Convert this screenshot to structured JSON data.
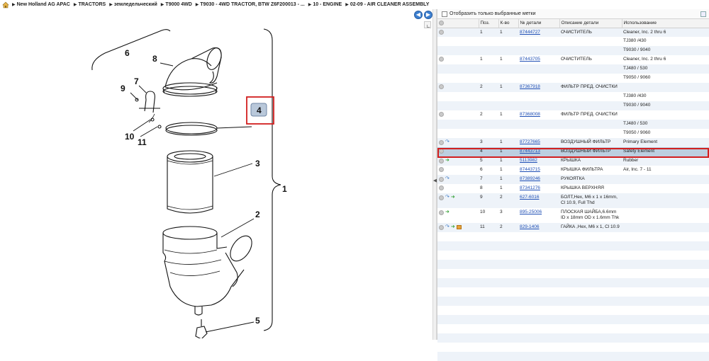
{
  "breadcrumb": {
    "items": [
      "New Holland AG APAC",
      "TRACTORS",
      "земледельческий",
      "T9000 4WD",
      "T9030 - 4WD TRACTOR, BTW Z6F200013 - ...",
      "10 - ENGINE",
      "02-09 - AIR CLEANER ASSEMBLY"
    ]
  },
  "nav": {
    "back_glyph": "◀",
    "forward_glyph": "▶"
  },
  "diagram": {
    "callouts": [
      "1",
      "2",
      "3",
      "4",
      "5",
      "6",
      "7",
      "8",
      "9",
      "10",
      "11"
    ],
    "highlight_color": "#d21f1f"
  },
  "filter": {
    "label": "Отобразить только выбранные метки"
  },
  "table": {
    "headers": [
      "",
      "Поз.",
      "К-во",
      "№ детали",
      "Описание детали",
      "Использование"
    ],
    "rows": [
      {
        "pos": "1",
        "qty": "1",
        "part": "87444727",
        "desc": "ОЧИСТИТЕЛЬ",
        "usage": "Cleaner, Inc. 2 thru 6",
        "icons": [
          "gray"
        ]
      },
      {
        "pos": "",
        "qty": "",
        "part": "",
        "desc": "",
        "usage": "TJ380 /430",
        "icons": []
      },
      {
        "pos": "",
        "qty": "",
        "part": "",
        "desc": "",
        "usage": "T9030 / 9040",
        "icons": []
      },
      {
        "pos": "1",
        "qty": "1",
        "part": "87443705",
        "desc": "ОЧИСТИТЕЛЬ",
        "usage": "Cleaner, Inc. 2 thru 6",
        "icons": [
          "gray"
        ]
      },
      {
        "pos": "",
        "qty": "",
        "part": "",
        "desc": "",
        "usage": "TJ480 / 530",
        "icons": []
      },
      {
        "pos": "",
        "qty": "",
        "part": "",
        "desc": "",
        "usage": "T9050 / 9060",
        "icons": []
      },
      {
        "pos": "2",
        "qty": "1",
        "part": "87367918",
        "desc": "ФИЛЬТР ПРЕД. ОЧИСТКИ",
        "usage": "",
        "icons": [
          "gray"
        ]
      },
      {
        "pos": "",
        "qty": "",
        "part": "",
        "desc": "",
        "usage": "TJ380 /430",
        "icons": []
      },
      {
        "pos": "",
        "qty": "",
        "part": "",
        "desc": "",
        "usage": "T9030 / 9040",
        "icons": []
      },
      {
        "pos": "2",
        "qty": "1",
        "part": "87368008",
        "desc": "ФИЛЬТР ПРЕД. ОЧИСТКИ",
        "usage": "",
        "icons": [
          "gray"
        ]
      },
      {
        "pos": "",
        "qty": "",
        "part": "",
        "desc": "",
        "usage": "TJ480 / 530",
        "icons": []
      },
      {
        "pos": "",
        "qty": "",
        "part": "",
        "desc": "",
        "usage": "T9050 / 9060",
        "icons": []
      },
      {
        "pos": "3",
        "qty": "1",
        "part": "87727665",
        "desc": "ВОЗДУШНЫЙ ФИЛЬТР",
        "usage": "Primary Element",
        "icons": [
          "gray",
          "blue"
        ]
      },
      {
        "pos": "4",
        "qty": "1",
        "part": "87443713",
        "desc": "ВОЗДУШНЫЙ ФИЛЬТР",
        "usage": "Safety Element",
        "icons": [
          "gray"
        ],
        "selected": true
      },
      {
        "pos": "5",
        "qty": "1",
        "part": "5113982",
        "desc": "КРЫШКА",
        "usage": "Rubber",
        "icons": [
          "gray",
          "green"
        ]
      },
      {
        "pos": "6",
        "qty": "1",
        "part": "87443715",
        "desc": "КРЫШКА ФИЛЬТРА",
        "usage": "Air, Inc. 7 - 11",
        "icons": [
          "gray"
        ]
      },
      {
        "pos": "7",
        "qty": "1",
        "part": "87389246",
        "desc": "РУКОЯТКА",
        "usage": "",
        "icons": [
          "gray",
          "blue"
        ]
      },
      {
        "pos": "8",
        "qty": "1",
        "part": "87341276",
        "desc": "КРЫШКА ВЕРХНЯЯ",
        "usage": "",
        "icons": [
          "gray"
        ]
      },
      {
        "pos": "9",
        "qty": "2",
        "part": "627-6016",
        "desc": "БОЛТ,Hex, M6 x 1 x 16mm, Cl 10.9, Full Thd",
        "usage": "",
        "icons": [
          "gray",
          "blue",
          "green"
        ],
        "tall": true
      },
      {
        "pos": "10",
        "qty": "3",
        "part": "895-25006",
        "desc": "ПЛОСКАЯ ШАЙБА,6.6mm ID x 18mm OD x 1.6mm Thk",
        "usage": "",
        "icons": [
          "gray",
          "green"
        ],
        "tall": true
      },
      {
        "pos": "11",
        "qty": "2",
        "part": "829-1406",
        "desc": "ГАЙКА ,Hex, M6 x 1, Cl 10.9",
        "usage": "",
        "icons": [
          "gray",
          "blue",
          "green",
          "orange"
        ]
      }
    ]
  }
}
